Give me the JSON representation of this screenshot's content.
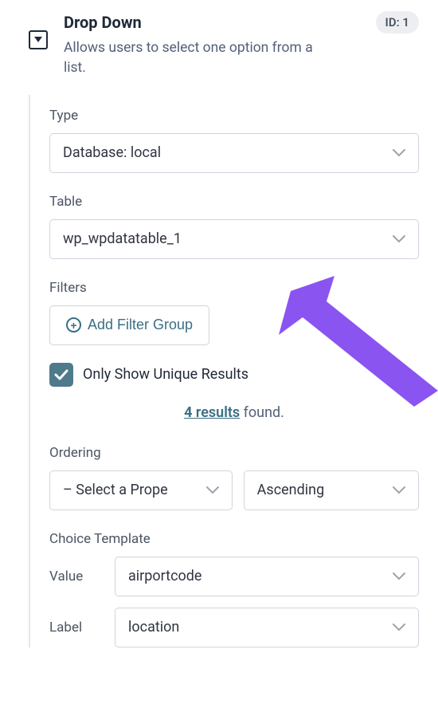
{
  "header": {
    "title": "Drop Down",
    "id_badge": "ID: 1",
    "description": "Allows users to select one option from a list."
  },
  "fields": {
    "type": {
      "label": "Type",
      "value": "Database: local"
    },
    "table": {
      "label": "Table",
      "value": "wp_wpdatatable_1"
    },
    "filters": {
      "label": "Filters",
      "add_group_label": "Add Filter Group",
      "unique_label": "Only Show Unique Results"
    },
    "results": {
      "count": "4",
      "word": "results",
      "suffix": " found."
    },
    "ordering": {
      "label": "Ordering",
      "property_value": "– Select a Prope",
      "direction_value": "Ascending"
    },
    "choice_template": {
      "label": "Choice Template",
      "value_label": "Value",
      "value_value": "airportcode",
      "label_label": "Label",
      "label_value": "location"
    }
  }
}
